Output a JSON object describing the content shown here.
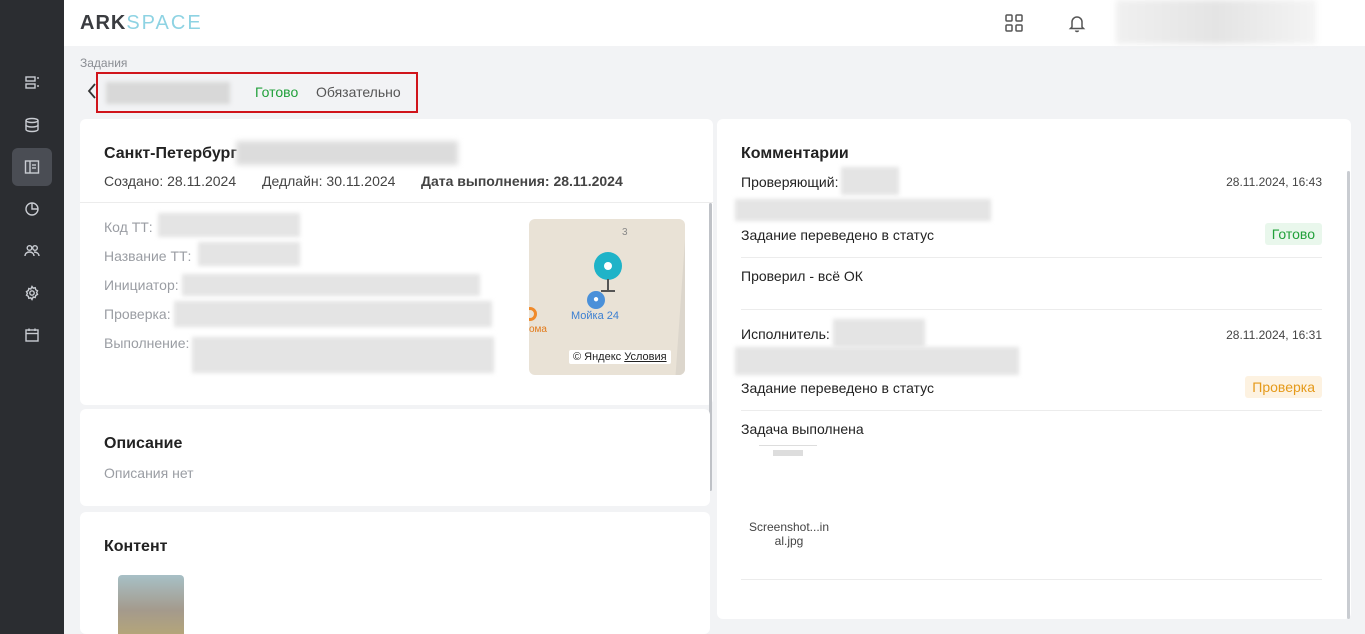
{
  "brand": {
    "part1": "ARK",
    "part2": "SPACE"
  },
  "sidebar": {
    "items": [
      "list-icon",
      "database-icon",
      "tasks-icon",
      "chart-icon",
      "users-icon",
      "gear-icon",
      "calendar-icon"
    ],
    "active_index": 2
  },
  "topbar": {
    "icons": [
      "apps-grid-icon",
      "bell-icon"
    ]
  },
  "breadcrumb": "Задания",
  "task": {
    "status": "Готово",
    "priority": "Обязательно"
  },
  "details": {
    "city": "Санкт-Петербург",
    "created": "Создано: 28.11.2024",
    "deadline": "Дедлайн: 30.11.2024",
    "completed_label": "Дата выполнения:",
    "completed_value": "28.11.2024",
    "fields": [
      "Код ТТ:",
      "Название ТТ:",
      "Инициатор:",
      "Проверка:",
      "Выполнение:"
    ]
  },
  "map": {
    "marker_label": "Мойка 24",
    "number": "3",
    "poi_partial": "ома",
    "copyright": "© Яндекс",
    "terms": "Условия"
  },
  "description": {
    "title": "Описание",
    "text": "Описания нет"
  },
  "content": {
    "title": "Контент"
  },
  "comments": {
    "title": "Комментарии",
    "entries": [
      {
        "role": "Проверяющий:",
        "time": "28.11.2024, 16:43",
        "status_text": "Задание переведено в статус",
        "status": "Готово",
        "comment": "Проверил - всё ОК"
      },
      {
        "role": "Исполнитель:",
        "time": "28.11.2024, 16:31",
        "status_text": "Задание переведено в статус",
        "status": "Проверка",
        "comment": "Задача выполнена",
        "file_line1": "Screenshot...in",
        "file_line2": "al.jpg"
      }
    ]
  }
}
